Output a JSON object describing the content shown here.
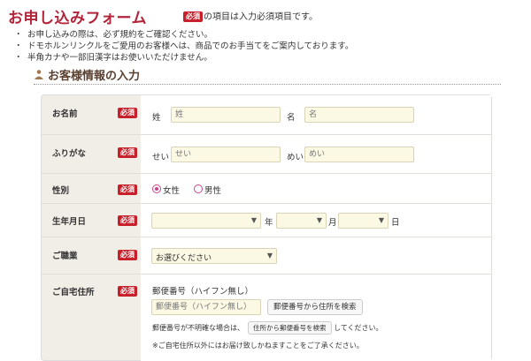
{
  "header": {
    "title": "お申し込みフォーム",
    "required_badge": "必須",
    "required_note": "の項目は入力必須項目です。"
  },
  "notes": [
    "お申し込みの際は、必ず規約をご確認ください。",
    "ドモホルンリンクルをご愛用のお客様へは、商品でのお手当てをご案内しております。",
    "半角カナや一部旧漢字はお使いいただけません。"
  ],
  "section": {
    "title": "お客様情報の入力",
    "icon": "person-icon"
  },
  "badge_label": "必須",
  "form": {
    "name": {
      "label": "お名前",
      "last_label": "姓",
      "last_placeholder": "姓",
      "first_label": "名",
      "first_placeholder": "名"
    },
    "kana": {
      "label": "ふりがな",
      "last_label": "せい",
      "last_placeholder": "せい",
      "first_label": "めい",
      "first_placeholder": "めい"
    },
    "gender": {
      "label": "性別",
      "options": [
        "女性",
        "男性"
      ],
      "selected": "女性",
      "accent_color": "#c8448a"
    },
    "birthdate": {
      "label": "生年月日",
      "year_unit": "年",
      "month_unit": "月",
      "day_unit": "日",
      "year_value": "",
      "month_value": "",
      "day_value": ""
    },
    "occupation": {
      "label": "ご職業",
      "selected": "お選びください"
    },
    "address": {
      "label": "ご自宅住所",
      "postal_label": "郵便番号（ハイフン無し）",
      "postal_placeholder": "郵便番号（ハイフン無し）",
      "search_button": "郵便番号から住所を検索",
      "unknown_prefix": "郵便番号が不明確な場合は、",
      "unknown_button": "住所から郵便番号を検索",
      "unknown_suffix": "してください。",
      "note": "※ご自宅住所以外にはお届け致しかねますことをご了承ください。"
    }
  },
  "colors": {
    "title": "#b2243a",
    "badge_bg": "#c8202b",
    "input_bg": "#fbf8e3",
    "label_bg": "#f1ede7"
  }
}
